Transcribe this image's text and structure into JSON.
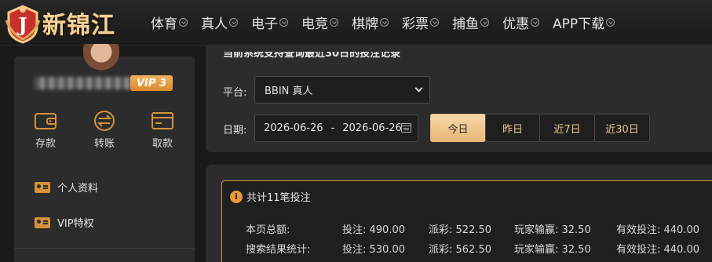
{
  "header": {
    "logo_text": "新锦江",
    "logo_letter": "J",
    "nav": [
      "体育",
      "真人",
      "电子",
      "电竞",
      "棋牌",
      "彩票",
      "捕鱼",
      "优惠"
    ],
    "app_download": "APP下载"
  },
  "profile": {
    "vip_label": "VIP 3",
    "actions": [
      {
        "label": "存款",
        "icon": "wallet-icon"
      },
      {
        "label": "转账",
        "icon": "transfer-icon"
      },
      {
        "label": "取款",
        "icon": "card-icon"
      }
    ],
    "menu": [
      {
        "label": "个人资料",
        "icon": "id-card-icon"
      },
      {
        "label": "VIP特权",
        "icon": "id-card-icon"
      }
    ]
  },
  "filter": {
    "notice": "当前系统支持查询最近30日的投注记录",
    "platform_label": "平台:",
    "platform_value": "BBIN 真人",
    "date_label": "日期:",
    "date_from": "2026-06-26",
    "date_separator": "-",
    "date_to": "2026-06-26",
    "ranges": [
      "今日",
      "昨日",
      "近7日",
      "近30日"
    ],
    "active_range": "今日"
  },
  "summary": {
    "title": "共计11笔投注",
    "rows": [
      {
        "label": "本页总额:",
        "bet": "投注: 490.00",
        "payout": "派彩: 522.50",
        "winloss": "玩家输赢: 32.50",
        "valid": "有效投注: 440.00"
      },
      {
        "label": "搜索结果统计:",
        "bet": "投注: 530.00",
        "payout": "派彩: 562.50",
        "winloss": "玩家输赢: 32.50",
        "valid": "有效投注: 440.00"
      }
    ]
  },
  "colors": {
    "accent": "#e8b777",
    "accent_text": "#f0c98e",
    "vip": "#e0973a",
    "panel": "#2c2c2c",
    "background": "#1a1a1a"
  }
}
